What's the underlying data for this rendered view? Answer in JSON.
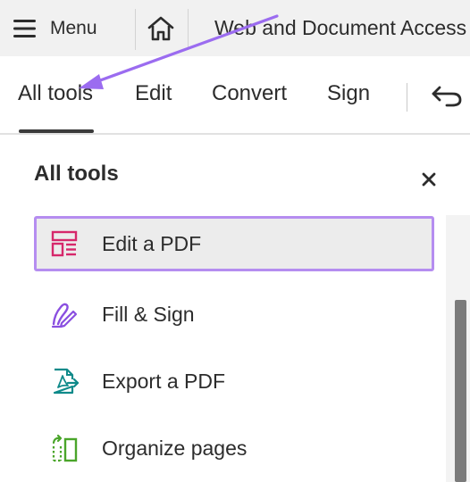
{
  "topbar": {
    "menu_label": "Menu",
    "document_title": "Web and Document Access"
  },
  "tabs": [
    {
      "label": "All tools",
      "active": true
    },
    {
      "label": "Edit",
      "active": false
    },
    {
      "label": "Convert",
      "active": false
    },
    {
      "label": "Sign",
      "active": false
    }
  ],
  "panel": {
    "title": "All tools",
    "close_glyph": "×",
    "tools": [
      {
        "label": "Edit a PDF",
        "icon": "edit-pdf-icon",
        "selected": true
      },
      {
        "label": "Fill & Sign",
        "icon": "fill-sign-icon",
        "selected": false
      },
      {
        "label": "Export a PDF",
        "icon": "export-pdf-icon",
        "selected": false
      },
      {
        "label": "Organize pages",
        "icon": "organize-pages-icon",
        "selected": false
      }
    ]
  },
  "colors": {
    "highlight_border": "#b58df0",
    "annotation_arrow": "#9b6cf0",
    "edit_icon": "#d6286b",
    "fill_sign_icon": "#8a4fe0",
    "export_icon": "#0f8a8a",
    "organize_icon": "#4aa52a"
  }
}
